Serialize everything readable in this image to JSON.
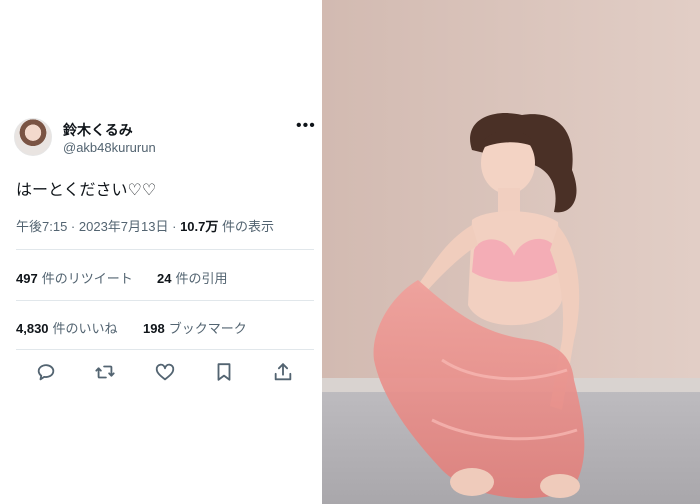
{
  "tweet": {
    "author": {
      "name": "鈴木くるみ",
      "handle": "@akb48kururun"
    },
    "more_glyph": "•••",
    "text": "はーとください♡♡",
    "meta": {
      "time": "午後7:15",
      "separator": " · ",
      "date": "2023年7月13日",
      "views_count": "10.7万",
      "views_label": "件の表示"
    },
    "stats": {
      "retweets": {
        "count": "497",
        "label": "件のリツイート"
      },
      "quotes": {
        "count": "24",
        "label": "件の引用"
      },
      "likes": {
        "count": "4,830",
        "label": "件のいいね"
      },
      "bookmarks": {
        "count": "198",
        "label": "ブックマーク"
      }
    },
    "actions": [
      "reply-icon",
      "retweet-icon",
      "like-icon",
      "bookmark-icon",
      "share-icon"
    ]
  },
  "photo": {
    "subject": "photo",
    "colors": {
      "wall": "#d9c2b9",
      "floor": "#b8b6b9",
      "tulle": "#e88b86"
    }
  }
}
